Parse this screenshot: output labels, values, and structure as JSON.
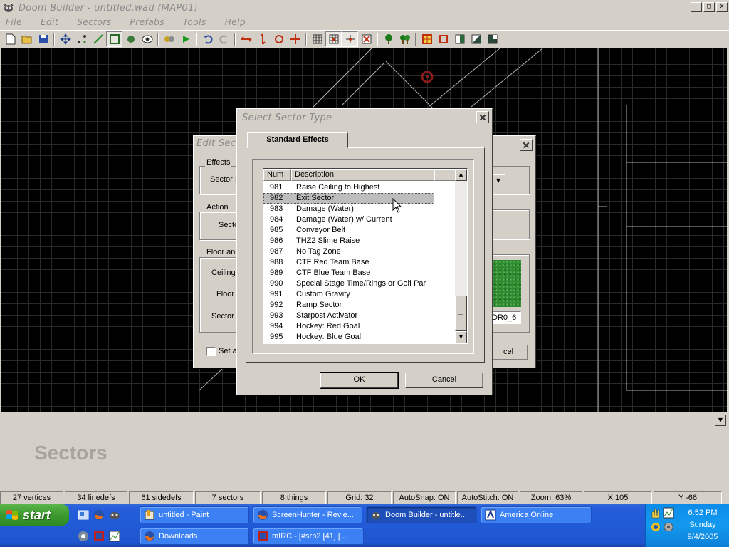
{
  "window": {
    "title": "Doom Builder - untitled.wad (MAP01)"
  },
  "menu": [
    "File",
    "Edit",
    "Sectors",
    "Prefabs",
    "Tools",
    "Help"
  ],
  "toolbar_icons": [
    "new-file",
    "open-folder",
    "save",
    "move",
    "vertices",
    "lines",
    "sectors",
    "things",
    "3d-mode",
    "sector-fx",
    "test-map",
    "undo",
    "redo",
    "flip-h",
    "flip-v",
    "rotate",
    "scale",
    "grid",
    "snap-grid",
    "stitch",
    "delete",
    "tree",
    "forest",
    "brightness",
    "outline",
    "half",
    "gradient",
    "texture"
  ],
  "info_panel": {
    "title": "Sectors"
  },
  "status": {
    "vertices": "27 vertices",
    "linedefs": "34 linedefs",
    "sidedefs": "61 sidedefs",
    "sectors": "7 sectors",
    "things": "8 things",
    "grid": "Grid: 32",
    "autosnap": "AutoSnap: ON",
    "autostitch": "AutoStitch: ON",
    "zoom": "Zoom: 63%",
    "x": "X 105",
    "y": "Y -66"
  },
  "edit_sector_dialog": {
    "title": "Edit Sec",
    "effects_group": "Effects",
    "sector_label": "Sector I",
    "action_group": "Action",
    "sector_tag_label": "Secto",
    "floor_group": "Floor and",
    "ceiling_label": "Ceiling",
    "floor_label": "Floor",
    "sector_brightness_label": "Sector",
    "set_checkbox": "Set a",
    "flat_name": "DR0_6",
    "cancel_partial": "cel"
  },
  "select_sector_dialog": {
    "title": "Select Sector Type",
    "tab": "Standard Effects",
    "columns": {
      "num": "Num",
      "description": "Description"
    },
    "selected_num": "982",
    "rows": [
      {
        "num": "981",
        "desc": "Raise Ceiling to Highest"
      },
      {
        "num": "982",
        "desc": "Exit Sector"
      },
      {
        "num": "983",
        "desc": "Damage (Water)"
      },
      {
        "num": "984",
        "desc": "Damage (Water) w/ Current"
      },
      {
        "num": "985",
        "desc": "Conveyor Belt"
      },
      {
        "num": "986",
        "desc": "THZ2 Slime Raise"
      },
      {
        "num": "987",
        "desc": "No Tag Zone"
      },
      {
        "num": "988",
        "desc": "CTF Red Team Base"
      },
      {
        "num": "989",
        "desc": "CTF Blue Team Base"
      },
      {
        "num": "990",
        "desc": "Special Stage Time/Rings or Golf Par"
      },
      {
        "num": "991",
        "desc": "Custom Gravity"
      },
      {
        "num": "992",
        "desc": "Ramp Sector"
      },
      {
        "num": "993",
        "desc": "Starpost Activator"
      },
      {
        "num": "994",
        "desc": "Hockey: Red Goal"
      },
      {
        "num": "995",
        "desc": "Hockey: Blue Goal"
      }
    ],
    "ok": "OK",
    "cancel": "Cancel"
  },
  "taskbar": {
    "start": "start",
    "row1": [
      "untitled - Paint",
      "ScreenHunter - Revie...",
      "Doom Builder - untitle...",
      "America Online"
    ],
    "row2": [
      "Downloads",
      "mIRC - [#srb2 [41] [..."
    ],
    "clock": {
      "time": "6:52 PM",
      "day": "Sunday",
      "date": "9/4/2005"
    }
  },
  "colors": {
    "accent": "#245edb",
    "start_green": "#3c9a2e",
    "map_line": "#a0a0a0",
    "thing_red": "#8b1a1a",
    "flat_green": "#2e8a2e"
  }
}
